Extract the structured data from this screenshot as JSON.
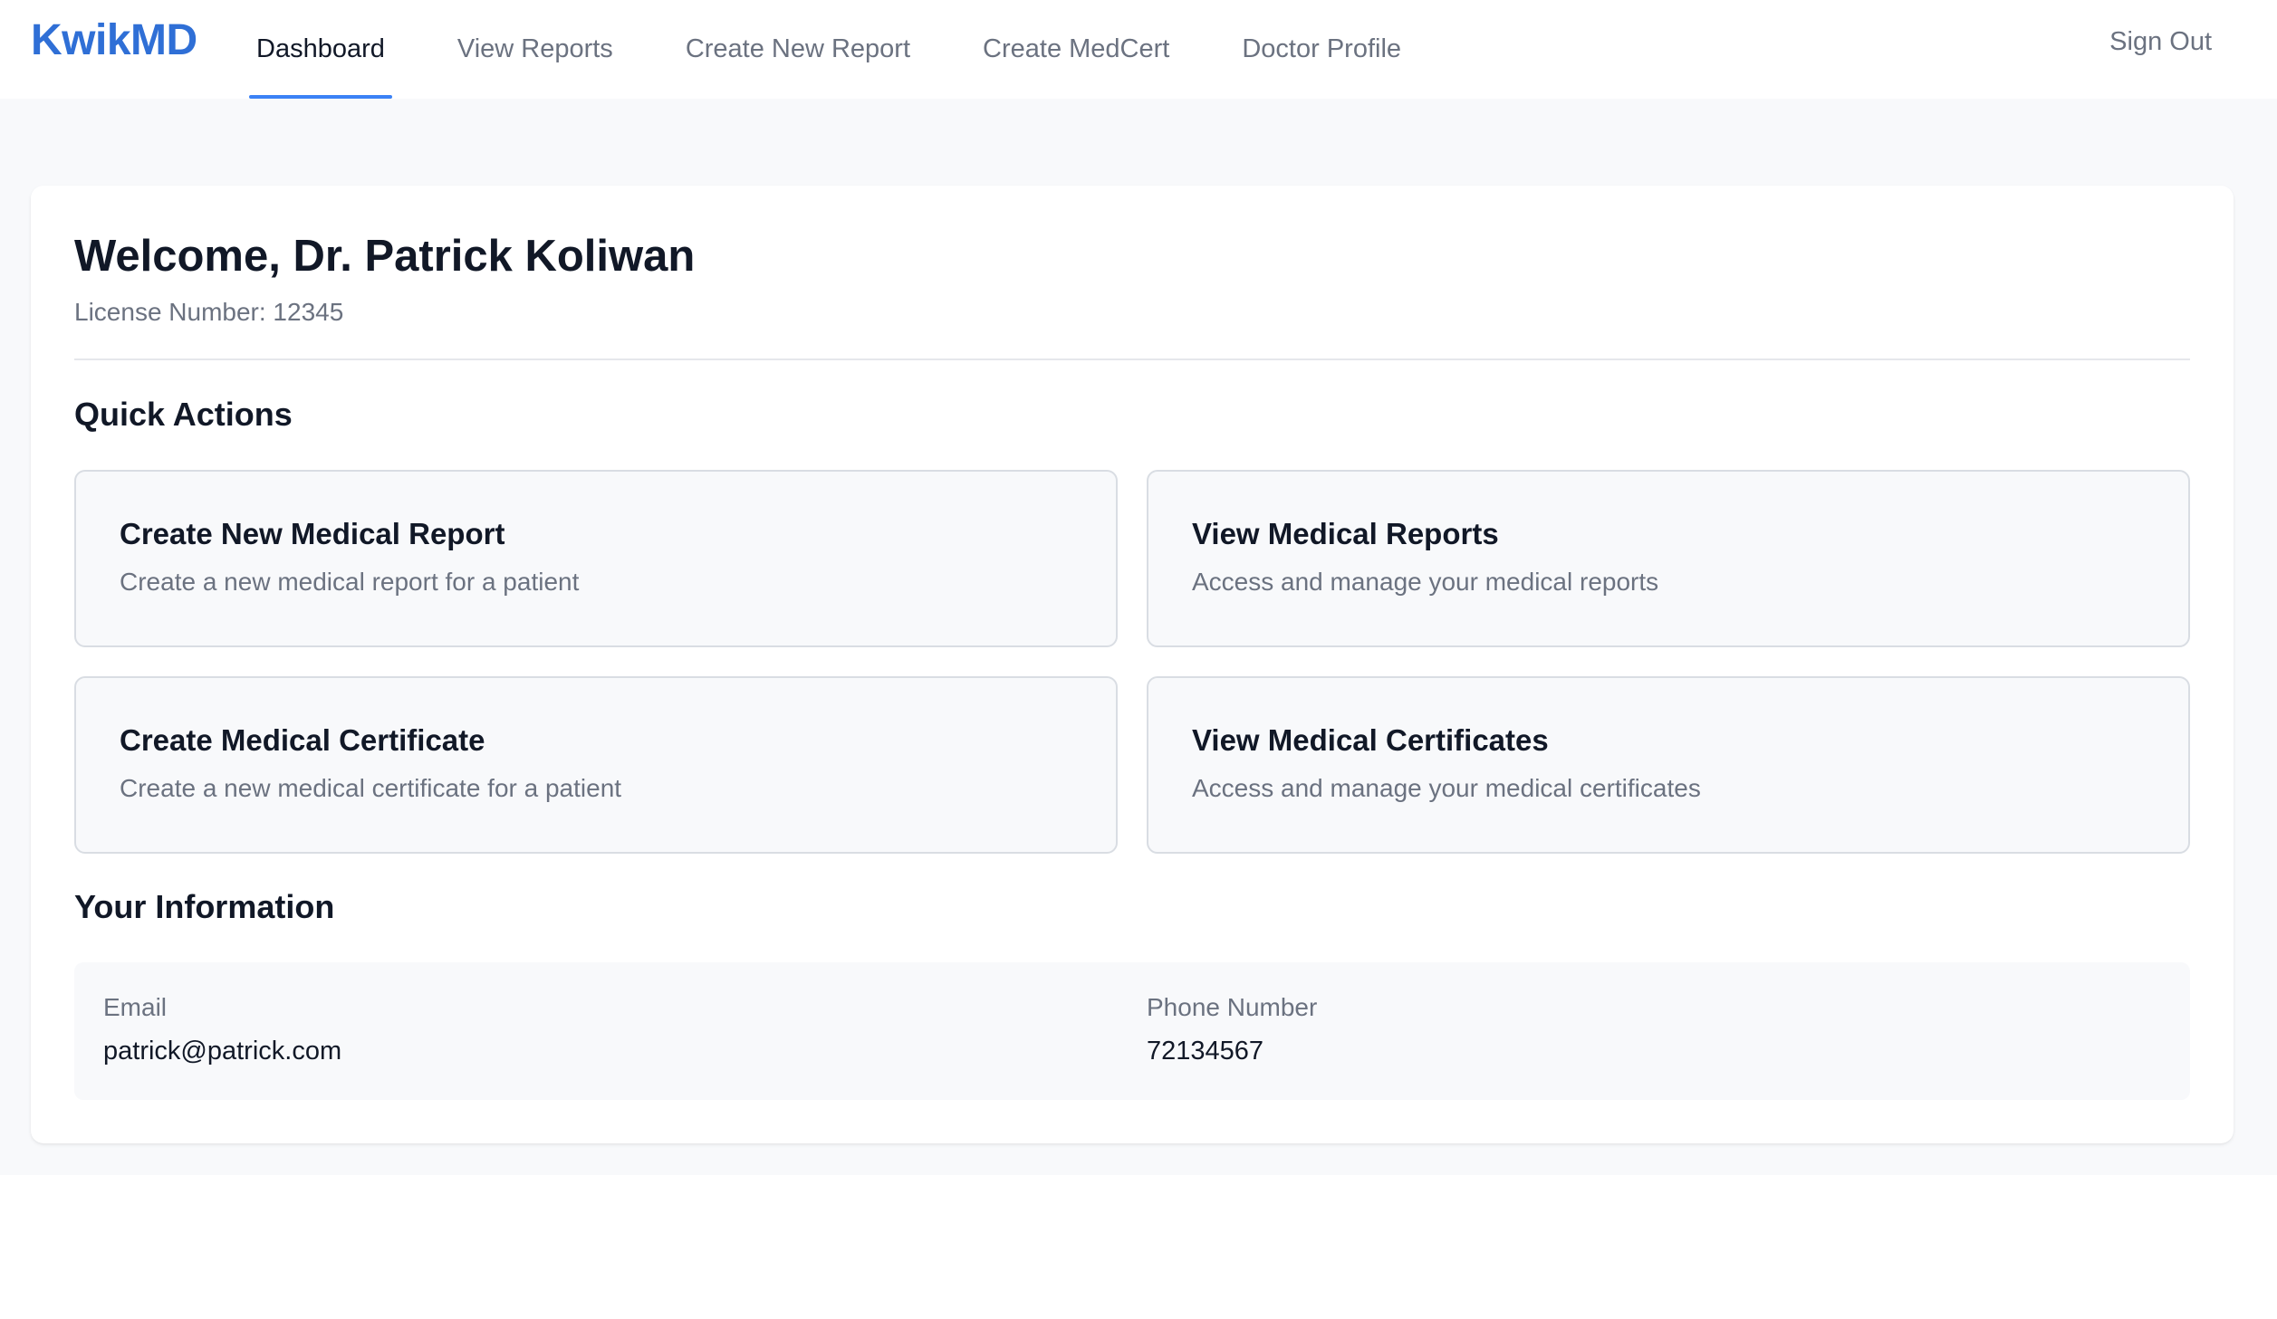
{
  "app": {
    "brand": "KwikMD"
  },
  "nav": {
    "tabs": [
      {
        "label": "Dashboard",
        "active": true
      },
      {
        "label": "View Reports",
        "active": false
      },
      {
        "label": "Create New Report",
        "active": false
      },
      {
        "label": "Create MedCert",
        "active": false
      },
      {
        "label": "Doctor Profile",
        "active": false
      }
    ],
    "sign_out": "Sign Out"
  },
  "welcome": {
    "title": "Welcome, Dr. Patrick Koliwan",
    "license": "License Number: 12345"
  },
  "quick_actions": {
    "title": "Quick Actions",
    "items": [
      {
        "title": "Create New Medical Report",
        "description": "Create a new medical report for a patient"
      },
      {
        "title": "View Medical Reports",
        "description": "Access and manage your medical reports"
      },
      {
        "title": "Create Medical Certificate",
        "description": "Create a new medical certificate for a patient"
      },
      {
        "title": "View Medical Certificates",
        "description": "Access and manage your medical certificates"
      }
    ]
  },
  "your_information": {
    "title": "Your Information",
    "email_label": "Email",
    "email_value": "patrick@patrick.com",
    "phone_label": "Phone Number",
    "phone_value": "72134567"
  },
  "colors": {
    "brand": "#2f6fd6",
    "active_tab_underline": "#3b82f6",
    "page_background": "#f8f9fb"
  }
}
